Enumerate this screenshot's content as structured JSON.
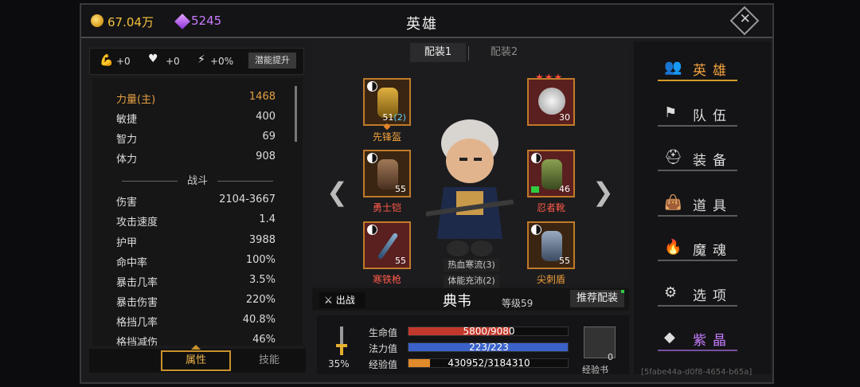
{
  "currency": {
    "gold": "67.04万",
    "gems": "5245"
  },
  "title": "英雄",
  "close_icon": "close-icon",
  "potential": {
    "strength_bonus": "+0",
    "health_bonus": "+0",
    "energy_bonus": "+0%",
    "button": "潜能提升"
  },
  "attributes": [
    {
      "label": "力量(主)",
      "value": "1468",
      "highlight": true
    },
    {
      "label": "敏捷",
      "value": "400"
    },
    {
      "label": "智力",
      "value": "69"
    },
    {
      "label": "体力",
      "value": "908"
    }
  ],
  "battle_header": "战斗",
  "battle": [
    {
      "label": "伤害",
      "value": "2104-3667"
    },
    {
      "label": "攻击速度",
      "value": "1.4"
    },
    {
      "label": "护甲",
      "value": "3988"
    },
    {
      "label": "命中率",
      "value": "100%"
    },
    {
      "label": "暴击几率",
      "value": "3.5%"
    },
    {
      "label": "暴击伤害",
      "value": "220%"
    },
    {
      "label": "格挡几率",
      "value": "40.8%"
    },
    {
      "label": "格挡减伤",
      "value": "46%"
    }
  ],
  "left_tabs": {
    "attributes": "属性",
    "skills": "技能"
  },
  "loadouts": [
    "配装1",
    "配装2"
  ],
  "equipment": {
    "helmet": {
      "name": "先锋盔",
      "level": "51",
      "extra": "(2)"
    },
    "armor": {
      "name": "勇士铠",
      "level": "55"
    },
    "weapon": {
      "name": "寒铁枪",
      "level": "55"
    },
    "pet": {
      "level": "30",
      "stars": "★★★"
    },
    "boots": {
      "name": "忍者靴",
      "level": "46"
    },
    "shield": {
      "name": "尖刺盾",
      "level": "55"
    }
  },
  "arrows": {
    "left": "❮",
    "right": "❯"
  },
  "hero_skills": [
    "热血寒流(3)",
    "体能充沛(2)"
  ],
  "hero": {
    "name": "典韦",
    "level_label": "等级59"
  },
  "deploy": "出战",
  "recommend": "推荐配装",
  "bars": {
    "hp": {
      "label": "生命值",
      "text": "5800/9080",
      "fill": 0.639,
      "color": "#c2392b"
    },
    "mp": {
      "label": "法力值",
      "text": "223/223",
      "fill": 1.0,
      "color": "#3a62c9"
    },
    "exp": {
      "label": "经验值",
      "text": "430952/3184310",
      "fill": 0.135,
      "color": "#e08a2c"
    }
  },
  "sword_percent": "35%",
  "exp_book": {
    "label": "经验书",
    "count": "0"
  },
  "nav": [
    {
      "label": "英雄",
      "icon": "people-icon",
      "glyph": "👥"
    },
    {
      "label": "队伍",
      "icon": "flag-icon",
      "glyph": "⚑"
    },
    {
      "label": "装备",
      "icon": "helmet-icon",
      "glyph": "⛑"
    },
    {
      "label": "道具",
      "icon": "bag-icon",
      "glyph": "👜"
    },
    {
      "label": "魔魂",
      "icon": "flame-icon",
      "glyph": "🔥"
    },
    {
      "label": "选项",
      "icon": "gear-icon",
      "glyph": "⚙"
    },
    {
      "label": "紫晶",
      "icon": "crystal-icon",
      "glyph": "◆"
    }
  ],
  "uid": "[5fabe44a-d0f8-4654-b65a]"
}
